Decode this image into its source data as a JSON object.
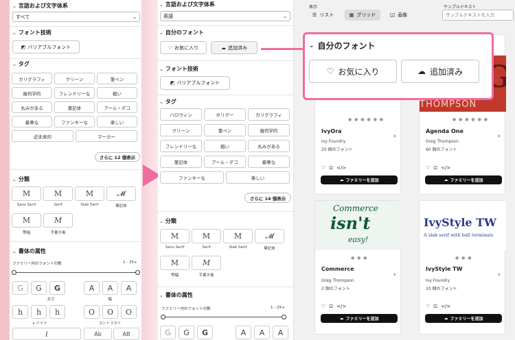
{
  "p1": {
    "lang_title": "言語および文字体系",
    "lang_value": "すべて",
    "tech_title": "フォント技術",
    "variable_btn": "バリアブルフォント",
    "tag_title": "タグ",
    "tags": [
      "カリグラフィ",
      "クリーン",
      "筆ペン",
      "幾何学的",
      "フレンドリーな",
      "粗い",
      "丸みがある",
      "筆記体",
      "アール・デコ",
      "豪華な",
      "ファンキーな",
      "楽しい",
      "近未来的",
      "マーカー"
    ],
    "more_tags": "さらに 12 個表示",
    "class_title": "分類",
    "classes": [
      "Sans Serif",
      "Serif",
      "Slab Serif",
      "筆記体",
      "等幅",
      "手書き風"
    ],
    "attr_title": "書体の属性",
    "fonts_in_family": "ファミリー内のフォントの数",
    "range": "1 - 25+",
    "weight_label": "太さ",
    "width_label": "幅",
    "xheight_label": "x ハイト",
    "contrast_label": "コントラスト"
  },
  "p2": {
    "lang_title": "言語および文字体系",
    "lang_value": "英語",
    "my_fonts_title": "自分のフォント",
    "fav_btn": "お気に入り",
    "added_btn": "追加済み",
    "tech_title": "フォント技術",
    "variable_btn": "バリアブルフォント",
    "tag_title": "タグ",
    "tags": [
      "ハロウィン",
      "ホリデー",
      "カリグラフィ",
      "クリーン",
      "筆ペン",
      "幾何学的",
      "フレンドリーな",
      "粗い",
      "丸みがある",
      "筆記体",
      "アール・デコ",
      "豪華な",
      "ファンキーな",
      "楽しい"
    ],
    "more_tags": "さらに 14 個表示",
    "class_title": "分類",
    "classes": [
      "Sans Serif",
      "Serif",
      "Slab Serif",
      "筆記体",
      "等幅",
      "手書き風"
    ],
    "attr_title": "書体の属性",
    "fonts_in_family": "ファミリー内のフォントの数",
    "range": "1 - 25+"
  },
  "p3": {
    "display_label": "表示",
    "list_label": "リスト",
    "grid_label": "グリッド",
    "image_label": "画像",
    "sample_label": "サンプルテキスト",
    "sample_placeholder": "サンプルテキストを入力",
    "popup": {
      "title": "自分のフォント",
      "fav_btn": "お気に入り",
      "added_btn": "追加済み"
    },
    "preview_partial": "THOMPSON",
    "cards": [
      {
        "name": "IvyOra",
        "foundry": "Ivy Foundry",
        "count": "20 個のフォント",
        "button": "ファミリーを追加"
      },
      {
        "name": "Agenda One",
        "foundry": "Greg Thompson",
        "count": "60 個のフォント",
        "button": "ファミリーを追加"
      },
      {
        "name": "Commerce",
        "foundry": "Greg Thompson",
        "count": "2 個のフォント",
        "button": "ファミリーを追加",
        "preview": [
          "Commerce",
          "isn't",
          "easy!"
        ]
      },
      {
        "name": "IvyStyle TW",
        "foundry": "Ivy Foundry",
        "count": "10 個のフォント",
        "button": "ファミリーを追加",
        "preview": [
          "IvyStyle TW",
          "A slab serif with ball terminals"
        ]
      }
    ]
  },
  "colors": {
    "accent": "#ef6ba2",
    "card_preview_dark": "#c0392b",
    "commerce_green": "#0f5a3a",
    "ivy_blue": "#2b3a8c",
    "ivy_red": "#d93a2f"
  }
}
